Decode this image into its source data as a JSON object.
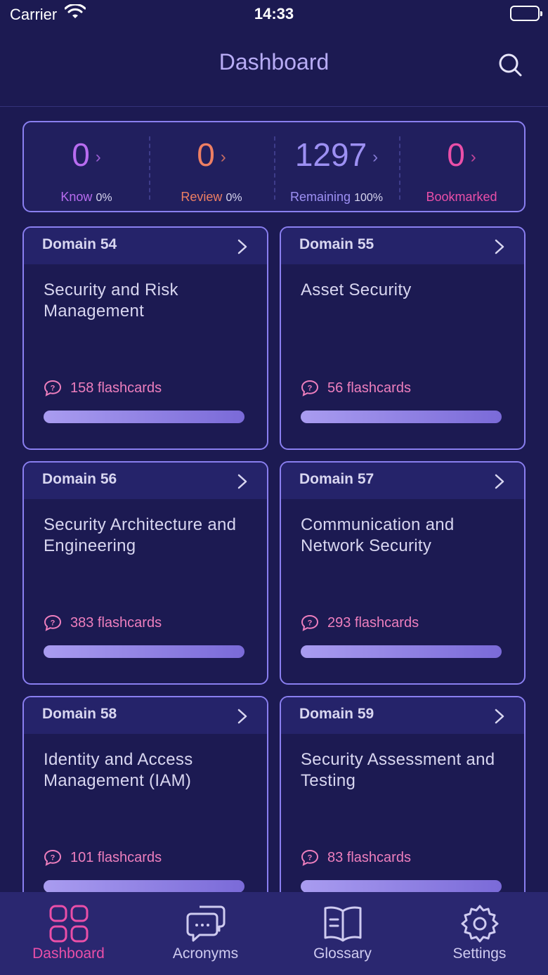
{
  "status": {
    "carrier": "Carrier",
    "time": "14:33"
  },
  "header": {
    "title": "Dashboard"
  },
  "stats": [
    {
      "value": "0",
      "label": "Know",
      "pct": "0%",
      "color": "#b86cf0"
    },
    {
      "value": "0",
      "label": "Review",
      "pct": "0%",
      "color": "#ee7f63"
    },
    {
      "value": "1297",
      "label": "Remaining",
      "pct": "100%",
      "color": "#9d90f3"
    },
    {
      "value": "0",
      "label": "Bookmarked",
      "pct": "",
      "color": "#ea4fa8"
    }
  ],
  "domains": [
    {
      "domain": "Domain 54",
      "title": "Security and Risk Management",
      "count": "158 flashcards",
      "progress": 1.0
    },
    {
      "domain": "Domain 55",
      "title": "Asset Security",
      "count": "56 flashcards",
      "progress": 1.0
    },
    {
      "domain": "Domain 56",
      "title": "Security Architecture and Engineering",
      "count": "383 flashcards",
      "progress": 1.0
    },
    {
      "domain": "Domain 57",
      "title": "Communication and Network Security",
      "count": "293 flashcards",
      "progress": 1.0
    },
    {
      "domain": "Domain 58",
      "title": "Identity and Access Management (IAM)",
      "count": "101 flashcards",
      "progress": 1.0
    },
    {
      "domain": "Domain 59",
      "title": "Security Assessment and Testing",
      "count": "83 flashcards",
      "progress": 1.0
    }
  ],
  "tabs": [
    {
      "label": "Dashboard",
      "icon": "grid-icon",
      "active": true
    },
    {
      "label": "Acronyms",
      "icon": "chat-bubbles-icon",
      "active": false
    },
    {
      "label": "Glossary",
      "icon": "book-icon",
      "active": false
    },
    {
      "label": "Settings",
      "icon": "gear-icon",
      "active": false
    }
  ]
}
